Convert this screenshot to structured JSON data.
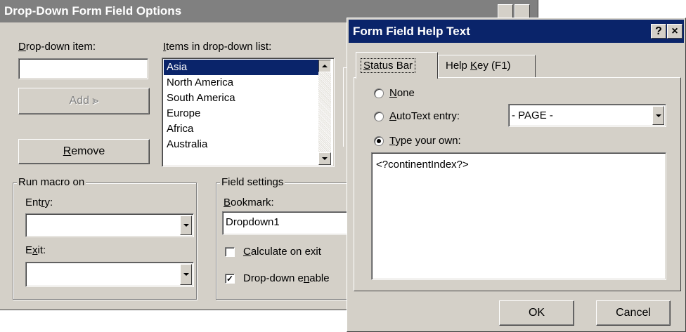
{
  "colors": {
    "titlebar_active": "#0a246a",
    "titlebar_inactive": "#808080",
    "selection": "#0a246a"
  },
  "dropdown_dialog": {
    "title": "Drop-Down Form Field Options",
    "dropdown_item_label": "Drop-down item:",
    "dropdown_item_value": "",
    "add_button": "Add »",
    "remove_button": "Remove",
    "items_label": "Items in drop-down list:",
    "items": [
      "Asia",
      "North America",
      "South America",
      "Europe",
      "Africa",
      "Australia"
    ],
    "selected_item": "Asia",
    "run_macro_group": "Run macro on",
    "entry_label": "Entry:",
    "entry_value": "",
    "exit_label": "Exit:",
    "exit_value": "",
    "field_settings_group": "Field settings",
    "bookmark_label": "Bookmark:",
    "bookmark_value": "Dropdown1",
    "calculate_on_exit": "Calculate on exit",
    "calculate_checked": false,
    "dropdown_enabled": "Drop-down enable",
    "dropdown_enabled_checked": true
  },
  "help_dialog": {
    "title": "Form Field Help Text",
    "help_button": "?",
    "close_button": "×",
    "tabs": [
      "Status Bar",
      "Help Key (F1)"
    ],
    "active_tab": "Status Bar",
    "radio_none": "None",
    "radio_autotext": "AutoText entry:",
    "autotext_value": "- PAGE -",
    "radio_type_own": "Type your own:",
    "selected_radio": "Type your own",
    "text_value": "<?continentIndex?>",
    "ok_button": "OK",
    "cancel_button": "Cancel"
  }
}
